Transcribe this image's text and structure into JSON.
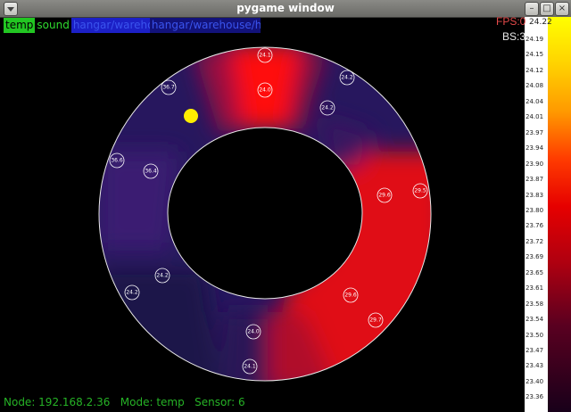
{
  "window": {
    "title": "pygame window"
  },
  "modes": {
    "temp": "temp",
    "sound": "sound",
    "btn3": "hangar/warehouse",
    "btn4": "hangar/warehouse/hangar"
  },
  "fps": "FPS:0",
  "bs": "BS:3",
  "status": "Node: 192.168.2.36   Mode: temp   Sensor: 6",
  "scale": {
    "top": "24.22",
    "ticks": [
      "24.19",
      "24.15",
      "24.12",
      "24.08",
      "24.04",
      "24.01",
      "23.97",
      "23.94",
      "23.90",
      "23.87",
      "23.83",
      "23.80",
      "23.76",
      "23.72",
      "23.69",
      "23.65",
      "23.61",
      "23.58",
      "23.54",
      "23.50",
      "23.47",
      "23.43",
      "23.40",
      "23.36"
    ]
  },
  "sensors": [
    "24.1",
    "24.0",
    "24.2",
    "24.2",
    "36.7",
    "36.6",
    "36.4",
    "29.6",
    "29.5",
    "24.2",
    "24.2",
    "29.6",
    "29.7",
    "24.0",
    "24.1"
  ],
  "colors": {
    "hot": "#ff0000",
    "cold": "#1c1450",
    "highlight": "#ffee00"
  }
}
